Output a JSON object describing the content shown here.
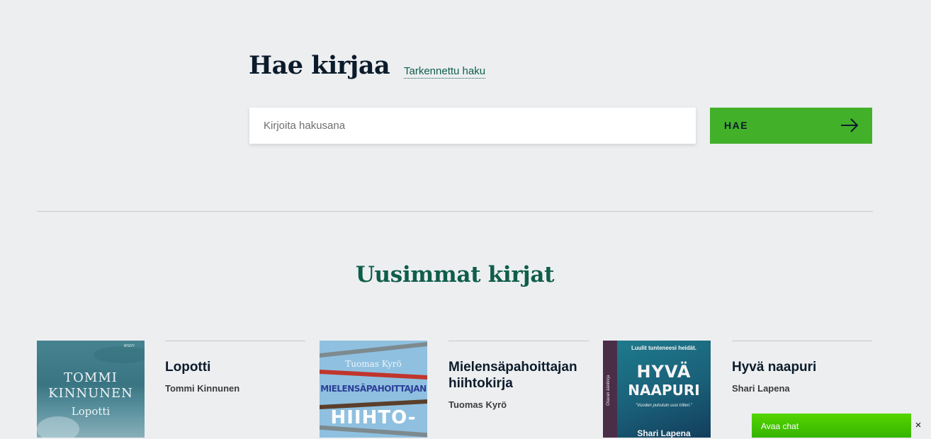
{
  "search": {
    "title": "Hae kirjaa",
    "advanced_link": "Tarkennettu haku",
    "placeholder": "Kirjoita hakusana",
    "button_label": "HAE",
    "button_icon": "arrow-right-icon"
  },
  "latest": {
    "title": "Uusimmat kirjat",
    "books": [
      {
        "title": "Lopotti",
        "author": "Tommi Kinnunen",
        "cover_author": "TOMMI KINNUNEN",
        "cover_title": "Lopotti",
        "cover_publisher": "WSOY"
      },
      {
        "title": "Mielensäpahoittajan hiihtokirja",
        "author": "Tuomas Kyrö",
        "cover_author": "Tuomas Kyrö",
        "cover_title_line1": "MIELENSÄPAHOITTAJAN",
        "cover_title_line2": "HIIHTO-"
      },
      {
        "title": "Hyvä naapuri",
        "author": "Shari Lapena",
        "cover_tagline": "Luulit tunteneesi heidät.",
        "cover_title_line1": "HYVÄ",
        "cover_title_line2": "NAAPURI",
        "cover_quote": "\"Vuoden puhutuin uusi trilleri.\"",
        "cover_side_text": "Otavan äänikirja",
        "cover_author": "Shari Lapena"
      }
    ]
  },
  "chat": {
    "label": "Avaa chat",
    "close": "×"
  },
  "colors": {
    "background": "#edeef0",
    "accent_green": "#43b02a",
    "heading_green": "#0e5e4a",
    "chat_green": "#4cc900"
  }
}
